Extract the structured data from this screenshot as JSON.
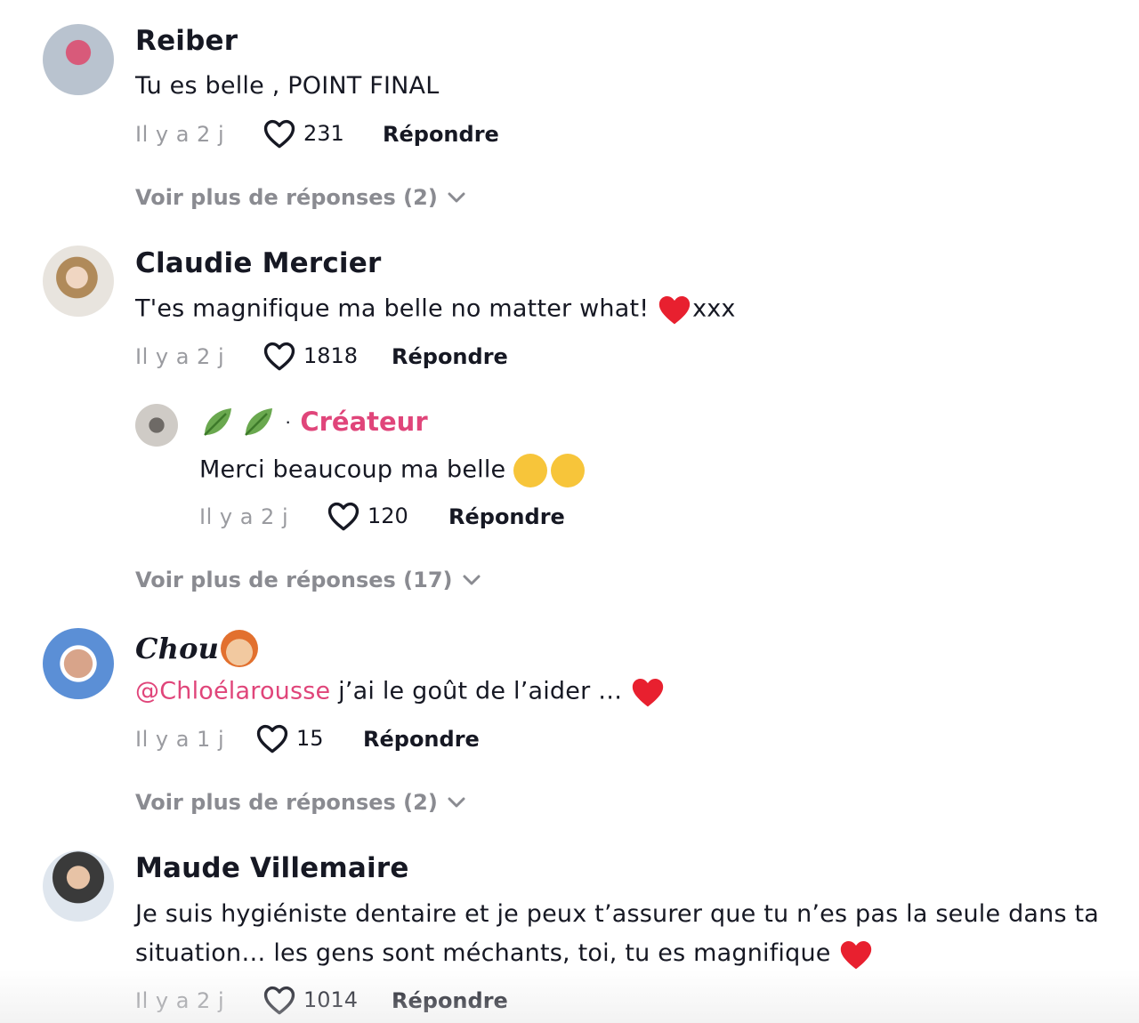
{
  "comments": [
    {
      "username": "Reiber",
      "text": "Tu es belle , POINT FINAL",
      "time": "Il y a 2 j",
      "likes": "231",
      "reply_label": "Répondre",
      "more_replies": "Voir plus de réponses (2)"
    },
    {
      "username": "Claudie Mercier",
      "text": "T'es magnifique ma belle no matter what! ",
      "text_suffix": "xxx",
      "time": "Il y a 2 j",
      "likes": "1818",
      "reply_label": "Répondre",
      "reply": {
        "creator_label": "Créateur",
        "dot": "·",
        "text": "Merci beaucoup ma belle ",
        "time": "Il y a 2 j",
        "likes": "120",
        "reply_label": "Répondre"
      },
      "more_replies": "Voir plus de réponses (17)"
    },
    {
      "username": "Chou",
      "mention": "@Chloélarousse",
      "text": " j’ai le goût de l’aider … ",
      "time": "Il y a 1 j",
      "likes": "15",
      "reply_label": "Répondre",
      "more_replies": "Voir plus de réponses (2)"
    },
    {
      "username": "Maude Villemaire",
      "text": "Je suis hygiéniste dentaire et je peux t’assurer que tu n’es pas la seule dans ta situation… les gens sont méchants, toi, tu es magnifique ",
      "time": "Il y a 2 j",
      "likes": "1014",
      "reply_label": "Répondre"
    }
  ],
  "colors": {
    "creator": "#e0457a",
    "mention": "#e0457a",
    "muted": "#9a9ba0",
    "heart_emoji": "#e8202f"
  },
  "icons": {
    "like": "heart-outline-icon",
    "expand": "chevron-down-icon",
    "emoji_heart": "red-heart-emoji",
    "emoji_leaf": "leaf-emoji"
  }
}
